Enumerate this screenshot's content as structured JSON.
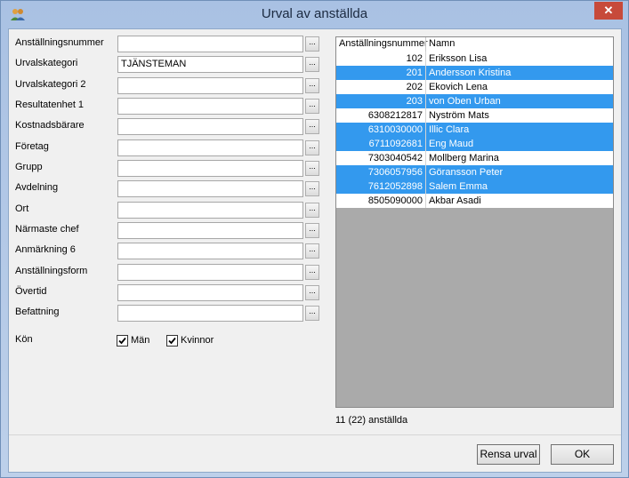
{
  "window": {
    "title": "Urval av anställda",
    "close_glyph": "✕"
  },
  "fields": [
    {
      "label": "Anställningsnummer",
      "value": ""
    },
    {
      "label": "Urvalskategori",
      "value": "TJÄNSTEMAN"
    },
    {
      "label": "Urvalskategori 2",
      "value": ""
    },
    {
      "label": "Resultatenhet 1",
      "value": ""
    },
    {
      "label": "Kostnadsbärare",
      "value": ""
    },
    {
      "label": "Företag",
      "value": ""
    },
    {
      "label": "Grupp",
      "value": ""
    },
    {
      "label": "Avdelning",
      "value": ""
    },
    {
      "label": "Ort",
      "value": ""
    },
    {
      "label": "Närmaste chef",
      "value": ""
    },
    {
      "label": "Anmärkning 6",
      "value": ""
    },
    {
      "label": "Anställningsform",
      "value": ""
    },
    {
      "label": "Övertid",
      "value": ""
    },
    {
      "label": "Befattning",
      "value": ""
    }
  ],
  "ellipsis_label": "...",
  "gender": {
    "label": "Kön",
    "options": [
      {
        "label": "Män",
        "checked": true
      },
      {
        "label": "Kvinnor",
        "checked": true
      }
    ]
  },
  "grid": {
    "columns": [
      "Anställningsnummer",
      "Namn"
    ],
    "rows": [
      {
        "number": "102",
        "name": "Eriksson Lisa",
        "selected": false
      },
      {
        "number": "201",
        "name": "Andersson Kristina",
        "selected": true
      },
      {
        "number": "202",
        "name": "Ekovich Lena",
        "selected": false
      },
      {
        "number": "203",
        "name": "von Oben Urban",
        "selected": true
      },
      {
        "number": "6308212817",
        "name": "Nyström Mats",
        "selected": false
      },
      {
        "number": "6310030000",
        "name": "Illic Clara",
        "selected": true
      },
      {
        "number": "6711092681",
        "name": "Eng Maud",
        "selected": true
      },
      {
        "number": "7303040542",
        "name": "Mollberg Marina",
        "selected": false
      },
      {
        "number": "7306057956",
        "name": "Göransson Peter",
        "selected": true
      },
      {
        "number": "7612052898",
        "name": "Salem Emma",
        "selected": true
      },
      {
        "number": "8505090000",
        "name": "Akbar Asadi",
        "selected": false
      }
    ]
  },
  "status": "11 (22) anställda",
  "buttons": {
    "clear": "Rensa urval",
    "ok": "OK"
  },
  "colors": {
    "selection": "#3399ee",
    "titlebar": "#b1c8e8",
    "close": "#c74a3a"
  }
}
